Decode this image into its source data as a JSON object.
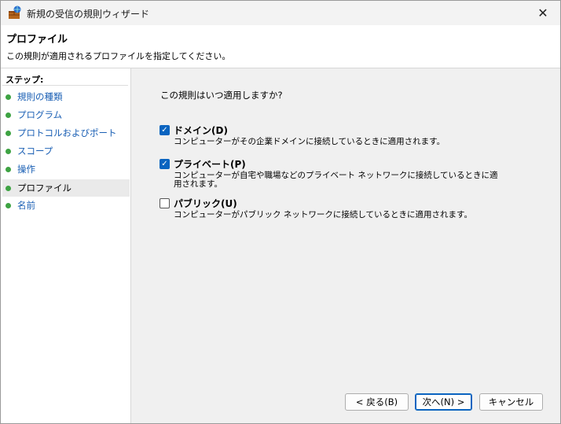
{
  "window": {
    "title": "新規の受信の規則ウィザード",
    "close_glyph": "✕"
  },
  "header": {
    "title": "プロファイル",
    "description": "この規則が適用されるプロファイルを指定してください。"
  },
  "sidebar": {
    "steps_label": "ステップ:",
    "items": [
      {
        "label": "規則の種類"
      },
      {
        "label": "プログラム"
      },
      {
        "label": "プロトコルおよびポート"
      },
      {
        "label": "スコープ"
      },
      {
        "label": "操作"
      },
      {
        "label": "プロファイル"
      },
      {
        "label": "名前"
      }
    ]
  },
  "main": {
    "question": "この規則はいつ適用しますか?",
    "options": [
      {
        "label": "ドメイン(D)",
        "checked": true,
        "description": "コンピューターがその企業ドメインに接続しているときに適用されます。"
      },
      {
        "label": "プライベート(P)",
        "checked": true,
        "description": "コンピューターが自宅や職場などのプライベート ネットワークに接続しているときに適用されます。"
      },
      {
        "label": "パブリック(U)",
        "checked": false,
        "description": "コンピューターがパブリック ネットワークに接続しているときに適用されます。"
      }
    ]
  },
  "buttons": {
    "back": "< 戻る(B)",
    "next": "次へ(N) >",
    "cancel": "キャンセル"
  },
  "colors": {
    "accent": "#0a64c0",
    "link": "#1a5fb4",
    "bullet": "#3ea343"
  }
}
